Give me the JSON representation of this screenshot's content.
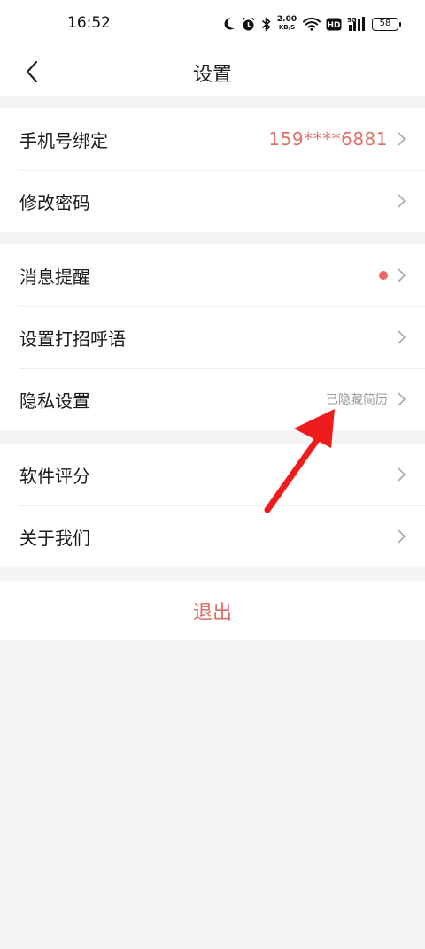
{
  "status_bar": {
    "time": "16:52",
    "net_speed": "2.00",
    "net_speed_unit": "KB/S",
    "hd_label": "HD",
    "signal_label": "5G",
    "battery": "58",
    "icons": [
      "moon-icon",
      "alarm-icon",
      "bluetooth-icon",
      "wifi-icon",
      "hd-icon",
      "signal-icon",
      "battery-icon"
    ]
  },
  "header": {
    "title": "设置",
    "back_icon": "chevron-left-icon"
  },
  "groups": [
    {
      "items": [
        {
          "label": "手机号绑定",
          "value": "159****6881"
        },
        {
          "label": "修改密码"
        }
      ]
    },
    {
      "items": [
        {
          "label": "消息提醒",
          "badge": "red-dot"
        },
        {
          "label": "设置打招呼语"
        },
        {
          "label": "隐私设置",
          "value": "已隐藏简历"
        }
      ]
    },
    {
      "items": [
        {
          "label": "软件评分"
        },
        {
          "label": "关于我们"
        }
      ]
    }
  ],
  "logout_label": "退出",
  "colors": {
    "accent_red": "#e06a62",
    "background": "#f5f5f7",
    "annotation_arrow": "#ee1c1c"
  }
}
